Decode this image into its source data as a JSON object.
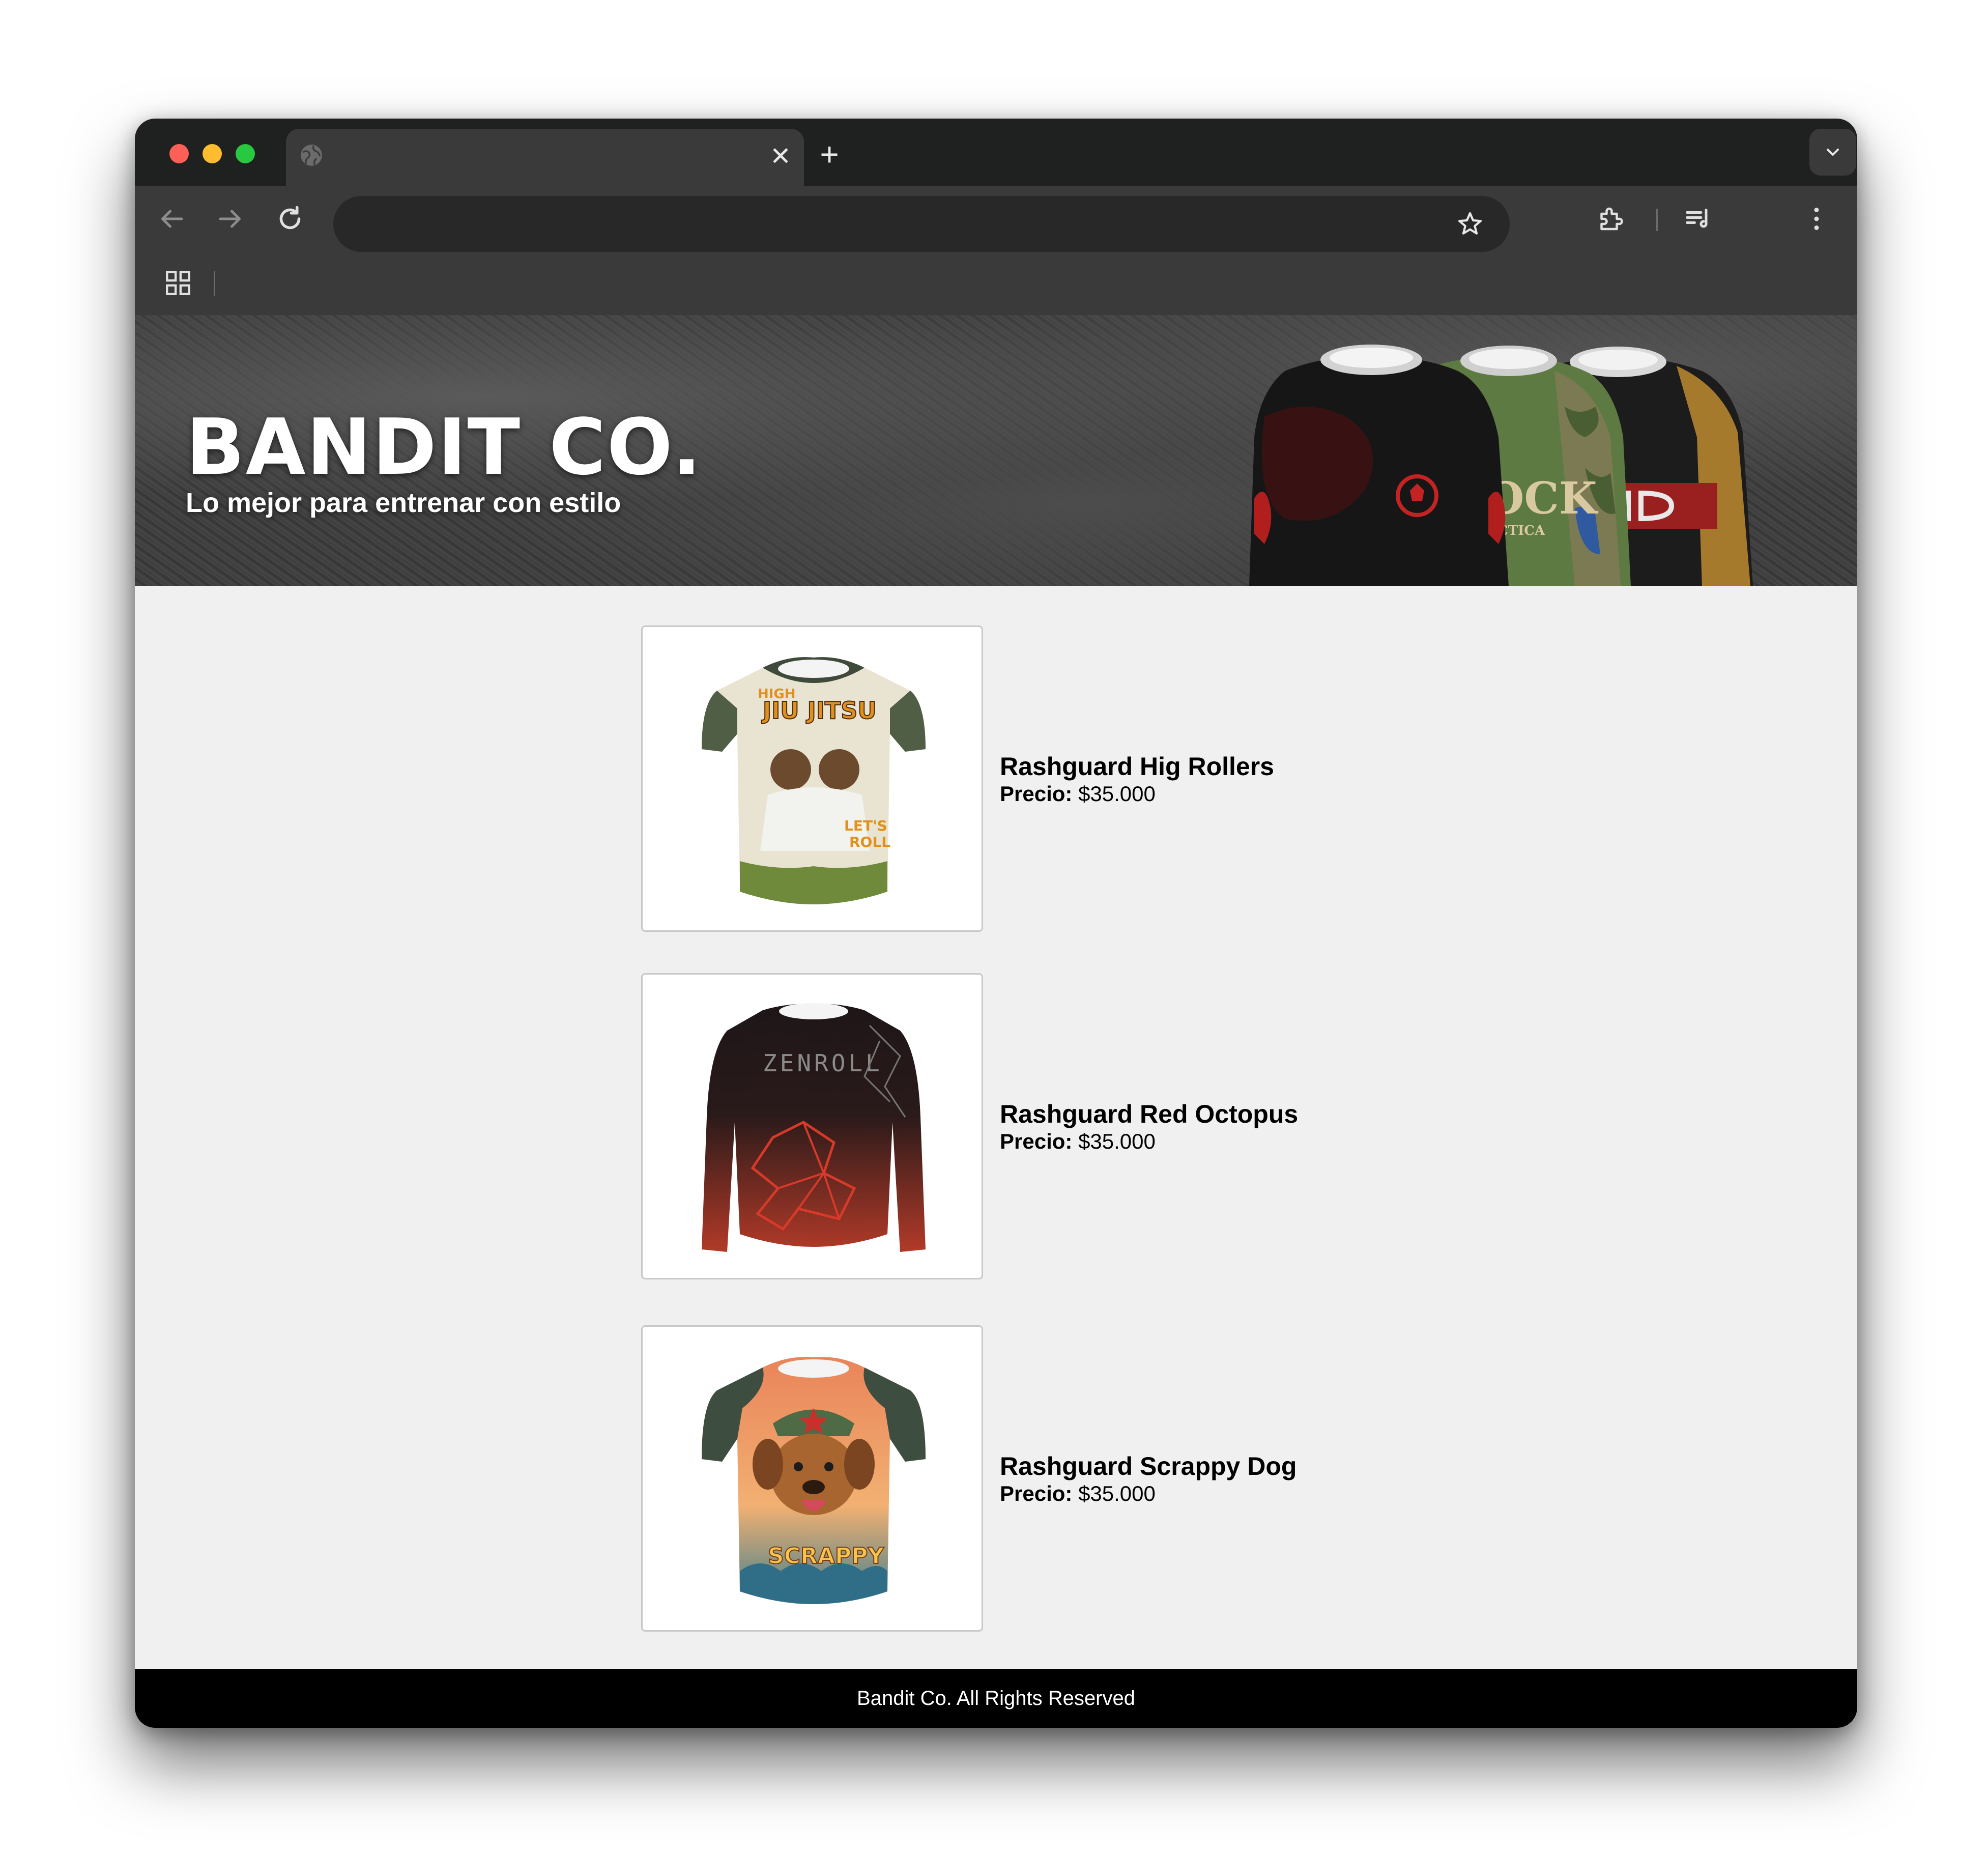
{
  "browser": {
    "tab_title": "",
    "tab_close_label": "✕",
    "new_tab_label": "+",
    "address_value": ""
  },
  "hero": {
    "title": "BANDIT CO.",
    "subtitle": "Lo mejor para entrenar con estilo"
  },
  "products": [
    {
      "name": "Rashguard Hig Rollers",
      "price_label": "Precio:",
      "price": "$35.000"
    },
    {
      "name": "Rashguard Red Octopus",
      "price_label": "Precio:",
      "price": "$35.000"
    },
    {
      "name": "Rashguard Scrappy Dog",
      "price_label": "Precio:",
      "price": "$35.000"
    }
  ],
  "footer": {
    "text": "Bandit Co. All Rights Reserved"
  },
  "colors": {
    "tabbar": "#1f2020",
    "toolbar": "#3a3a3a",
    "page_bg": "#f0f0f0",
    "footer_bg": "#000000"
  }
}
